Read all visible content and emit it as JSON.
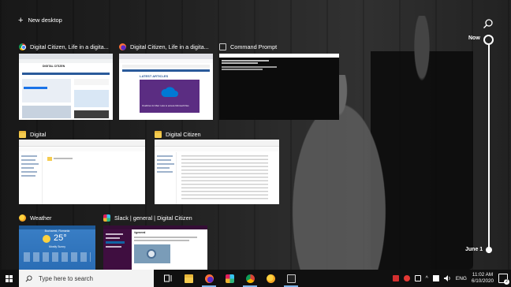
{
  "top": {
    "new_desktop_label": "New desktop"
  },
  "timeline": {
    "now_label": "Now",
    "date_label": "June 1"
  },
  "windows": [
    {
      "title": "Digital Citizen, Life in a digita...",
      "icon": "chrome-icon"
    },
    {
      "title": "Digital Citizen, Life in a digita...",
      "icon": "firefox-icon"
    },
    {
      "title": "Command Prompt",
      "icon": "command-prompt-icon"
    },
    {
      "title": "Digital",
      "icon": "folder-icon"
    },
    {
      "title": "Digital Citizen",
      "icon": "folder-icon"
    },
    {
      "title": "Weather",
      "icon": "weather-icon"
    },
    {
      "title": "Slack | general | Digital Citizen",
      "icon": "slack-icon"
    }
  ],
  "thumb_text": {
    "site_name": "DIGITAL CITIZEN",
    "latest_articles": "LATEST ARTICLES",
    "onedrive_caption": "OneDrive for Mac: How to access Microsoft files",
    "weather_city": "Bucharest, Romania",
    "weather_temp": "25°",
    "weather_cond": "Mostly Sunny",
    "slack_channel": "#general"
  },
  "taskbar": {
    "search_placeholder": "Type here to search",
    "language": "ENG",
    "time": "11:02 AM",
    "date": "6/10/2020",
    "notification_count": "2"
  },
  "colors": {
    "taskbar_bg": "#101010",
    "accent_underline": "#7fb4e8",
    "onedrive_purple": "#5b2d82",
    "cmd_bg": "#0c0c0c",
    "weather_blue": "#2a6db5",
    "slack_purple": "#3f0e40"
  }
}
